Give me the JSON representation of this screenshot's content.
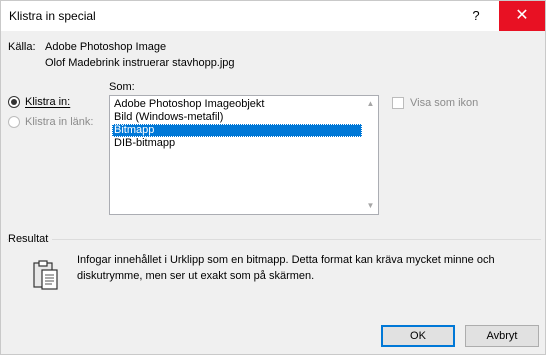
{
  "window": {
    "title": "Klistra in special",
    "help": "?",
    "close": "✕"
  },
  "source": {
    "label": "Källa:",
    "app": "Adobe Photoshop Image",
    "file": "Olof Madebrink instruerar stavhopp.jpg"
  },
  "paste_options": {
    "paste": "Klistra in:",
    "paste_link": "Klistra in länk:"
  },
  "as": {
    "label": "Som:",
    "items": [
      "Adobe Photoshop Imageobjekt",
      "Bild (Windows-metafil)",
      "Bitmapp",
      "DIB-bitmapp"
    ],
    "selected_index": 2
  },
  "display_as_icon": {
    "label": "Visa som ikon",
    "checked": false
  },
  "result": {
    "label": "Resultat",
    "text": "Infogar innehållet i Urklipp som en bitmapp. Detta format kan kräva mycket minne och diskutrymme, men ser ut exakt som på skärmen.",
    "icon": "clipboard-icon"
  },
  "buttons": {
    "ok": "OK",
    "cancel": "Avbryt"
  }
}
